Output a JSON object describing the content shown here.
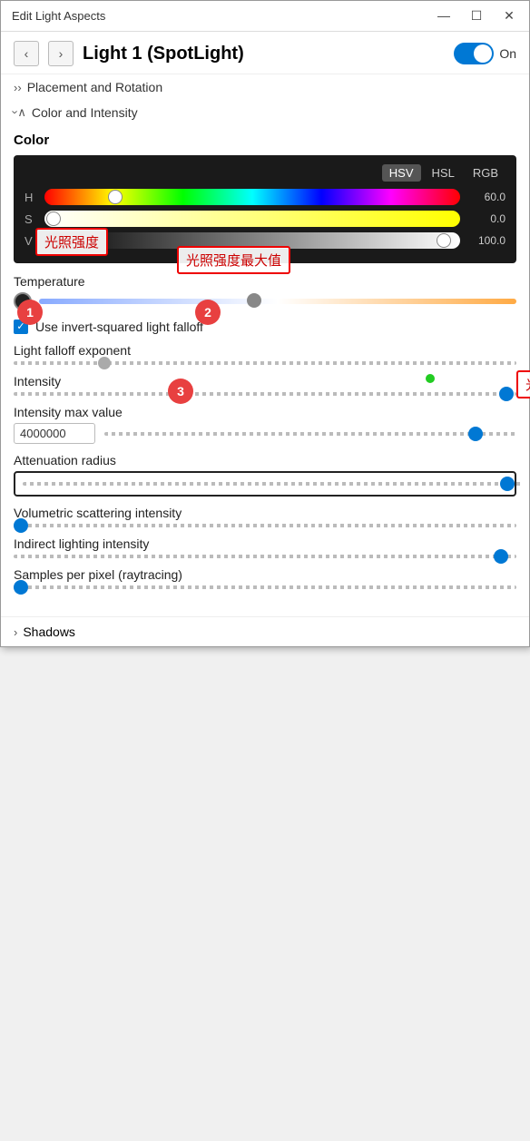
{
  "window": {
    "title": "Edit Light Aspects",
    "controls": [
      "—",
      "☐",
      "✕"
    ]
  },
  "header": {
    "nav_back": "‹",
    "nav_forward": "›",
    "light_name": "Light 1 (SpotLight)",
    "toggle_state": "On",
    "toggle_on": true
  },
  "sections": {
    "placement": {
      "label": "Placement and Rotation",
      "expanded": false,
      "chevron": "›"
    },
    "color_intensity": {
      "label": "Color and Intensity",
      "expanded": true,
      "chevron": "∧"
    }
  },
  "color": {
    "label": "Color",
    "tabs": [
      "HSV",
      "HSL",
      "RGB"
    ],
    "active_tab": "HSV",
    "sliders": [
      {
        "label": "H",
        "value": "60.0",
        "position": 0.17
      },
      {
        "label": "S",
        "value": "0.0",
        "position": 0.02
      },
      {
        "label": "V",
        "value": "100.0",
        "position": 0.95
      }
    ]
  },
  "temperature": {
    "label": "Temperature",
    "thumb_position": 0.45
  },
  "checkbox": {
    "label": "Use invert-squared light falloff",
    "checked": true
  },
  "light_falloff": {
    "label": "Light falloff exponent",
    "thumb_position": 0.18
  },
  "intensity": {
    "label": "Intensity",
    "thumb_position": 0.98
  },
  "intensity_max": {
    "label": "Intensity max value",
    "input_value": "4000000",
    "thumb_position": 0.9
  },
  "attenuation": {
    "label": "Attenuation radius",
    "thumb_position": 0.97
  },
  "volumetric": {
    "label": "Volumetric scattering intensity",
    "thumb_position": 0.03
  },
  "indirect": {
    "label": "Indirect lighting intensity",
    "thumb_position": 0.97
  },
  "samples": {
    "label": "Samples per pixel (raytracing)",
    "thumb_position": 0.03
  },
  "shadows": {
    "label": "Shadows",
    "chevron": "›"
  },
  "annotations": {
    "box1": "光照强度",
    "box2": "光照强度最大值",
    "box3": "光照的衰减范围",
    "circle1": "1",
    "circle2": "2",
    "circle3": "3"
  }
}
